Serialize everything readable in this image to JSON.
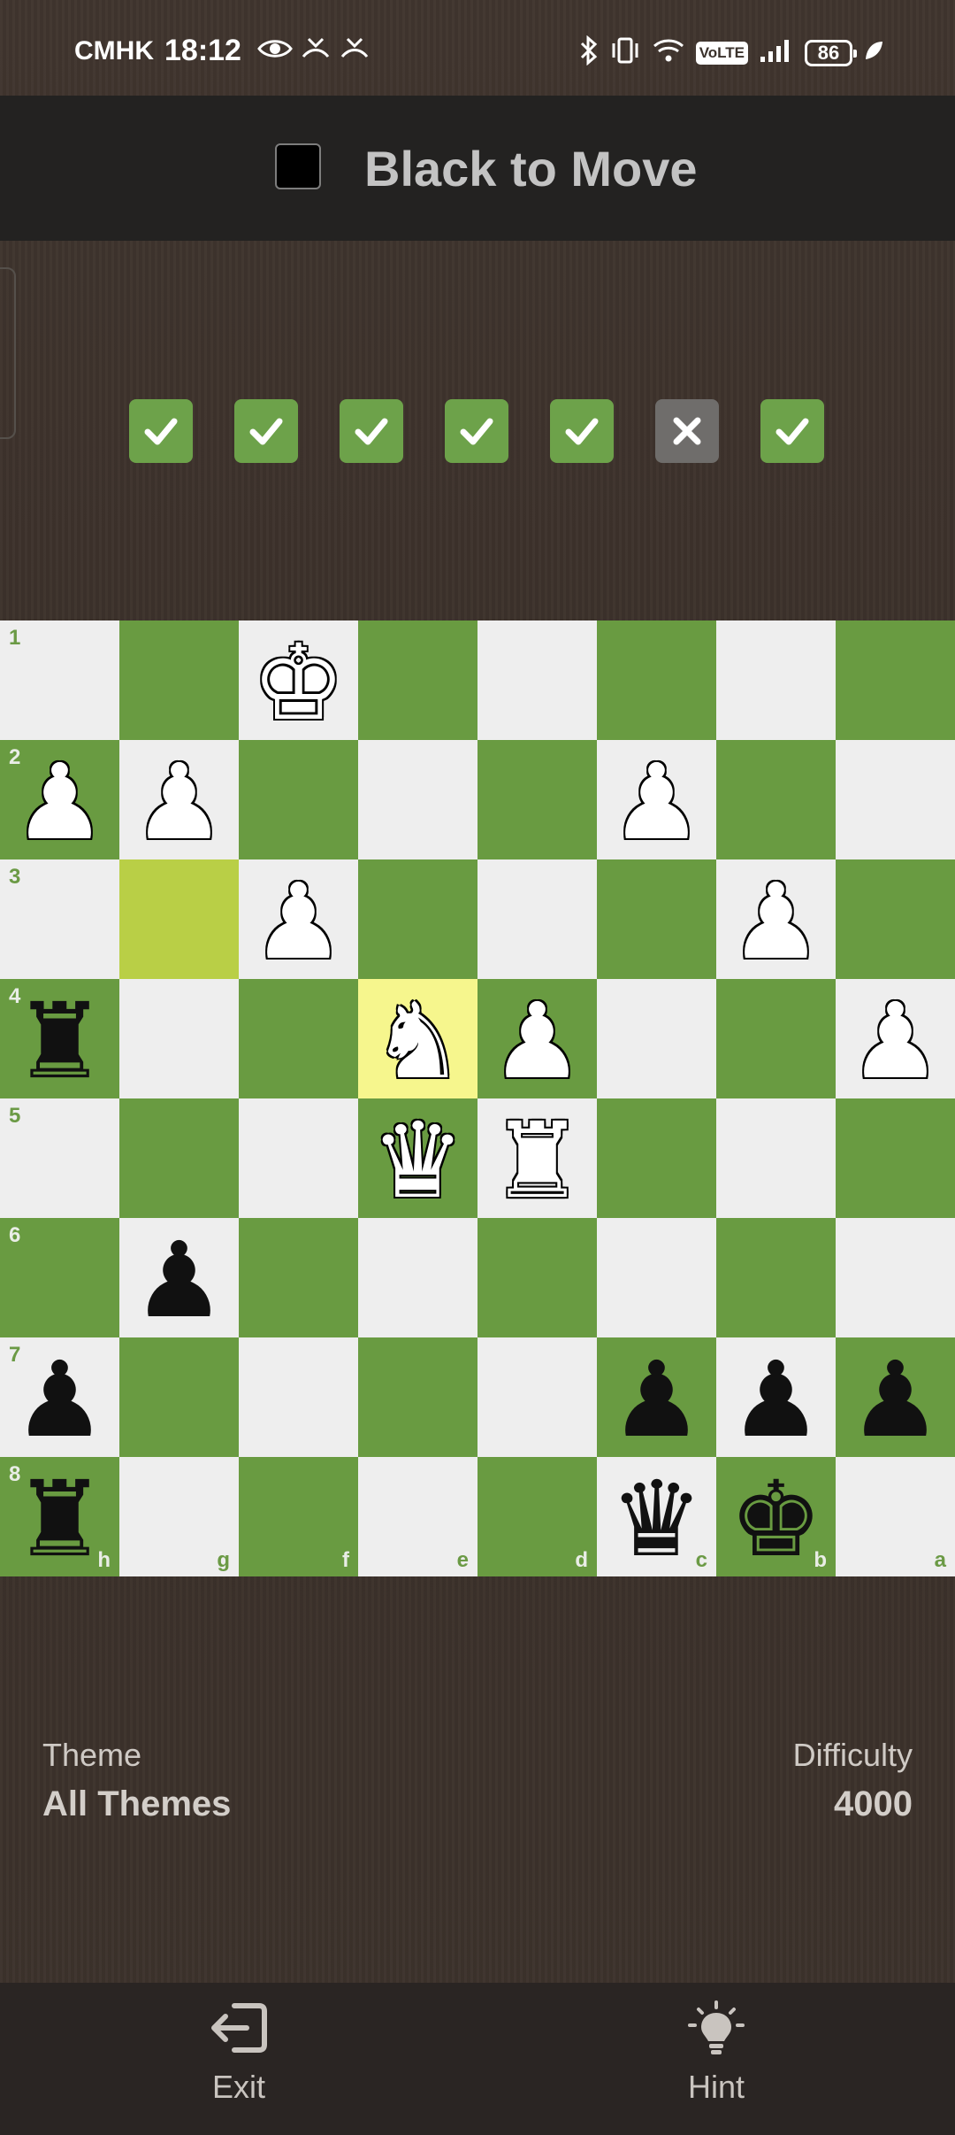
{
  "status_bar": {
    "carrier": "CMHK",
    "time": "18:12",
    "network": "VoLTE",
    "battery": "86"
  },
  "header": {
    "turn_text": "Black to Move",
    "turn_color": "#000000"
  },
  "progress": {
    "results": [
      "correct",
      "correct",
      "correct",
      "correct",
      "correct",
      "incorrect",
      "correct"
    ]
  },
  "board": {
    "orientation": "black",
    "rank_labels": [
      "1",
      "2",
      "3",
      "4",
      "5",
      "6",
      "7",
      "8"
    ],
    "file_labels": [
      "h",
      "g",
      "f",
      "e",
      "d",
      "c",
      "b",
      "a"
    ],
    "last_move": {
      "from": "g3",
      "to": "e4"
    },
    "pieces": [
      {
        "square": "f1",
        "piece": "K",
        "color": "white"
      },
      {
        "square": "h2",
        "piece": "P",
        "color": "white"
      },
      {
        "square": "g2",
        "piece": "P",
        "color": "white"
      },
      {
        "square": "c2",
        "piece": "P",
        "color": "white"
      },
      {
        "square": "f3",
        "piece": "P",
        "color": "white"
      },
      {
        "square": "b3",
        "piece": "P",
        "color": "white"
      },
      {
        "square": "h4",
        "piece": "R",
        "color": "black"
      },
      {
        "square": "e4",
        "piece": "N",
        "color": "white"
      },
      {
        "square": "d4",
        "piece": "P",
        "color": "white"
      },
      {
        "square": "a4",
        "piece": "P",
        "color": "white"
      },
      {
        "square": "e5",
        "piece": "Q",
        "color": "white"
      },
      {
        "square": "d5",
        "piece": "R",
        "color": "white"
      },
      {
        "square": "g6",
        "piece": "P",
        "color": "black"
      },
      {
        "square": "h7",
        "piece": "P",
        "color": "black"
      },
      {
        "square": "c7",
        "piece": "P",
        "color": "black"
      },
      {
        "square": "b7",
        "piece": "P",
        "color": "black"
      },
      {
        "square": "a7",
        "piece": "P",
        "color": "black"
      },
      {
        "square": "h8",
        "piece": "R",
        "color": "black"
      },
      {
        "square": "c8",
        "piece": "Q",
        "color": "black"
      },
      {
        "square": "b8",
        "piece": "K",
        "color": "black"
      }
    ]
  },
  "info": {
    "theme_label": "Theme",
    "theme_value": "All Themes",
    "difficulty_label": "Difficulty",
    "difficulty_value": "4000"
  },
  "bottom_bar": {
    "exit_label": "Exit",
    "exit_icon": "exit-icon",
    "hint_label": "Hint",
    "hint_icon": "lightbulb-icon"
  }
}
